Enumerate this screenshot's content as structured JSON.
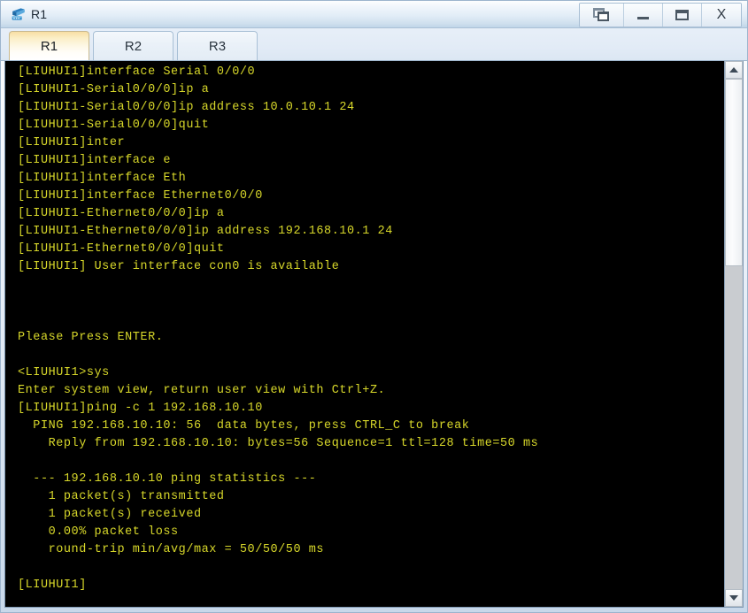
{
  "window": {
    "title": "R1",
    "icon": "router-icon",
    "controls": {
      "restore_label": "",
      "minimize_label": "",
      "maximize_label": "",
      "close_label": "X"
    }
  },
  "tabs": [
    {
      "label": "R1",
      "active": true
    },
    {
      "label": "R2",
      "active": false
    },
    {
      "label": "R3",
      "active": false
    }
  ],
  "terminal": {
    "foreground_color": "#d8d82a",
    "background_color": "#000000",
    "lines": [
      "[LIUHUI1]interface Serial 0/0/0",
      "[LIUHUI1-Serial0/0/0]ip a",
      "[LIUHUI1-Serial0/0/0]ip address 10.0.10.1 24",
      "[LIUHUI1-Serial0/0/0]quit",
      "[LIUHUI1]inter",
      "[LIUHUI1]interface e",
      "[LIUHUI1]interface Eth",
      "[LIUHUI1]interface Ethernet0/0/0",
      "[LIUHUI1-Ethernet0/0/0]ip a",
      "[LIUHUI1-Ethernet0/0/0]ip address 192.168.10.1 24",
      "[LIUHUI1-Ethernet0/0/0]quit",
      "[LIUHUI1] User interface con0 is available",
      "",
      "",
      "",
      "Please Press ENTER.",
      "",
      "<LIUHUI1>sys",
      "Enter system view, return user view with Ctrl+Z.",
      "[LIUHUI1]ping -c 1 192.168.10.10",
      "  PING 192.168.10.10: 56  data bytes, press CTRL_C to break",
      "    Reply from 192.168.10.10: bytes=56 Sequence=1 ttl=128 time=50 ms",
      "",
      "  --- 192.168.10.10 ping statistics ---",
      "    1 packet(s) transmitted",
      "    1 packet(s) received",
      "    0.00% packet loss",
      "    round-trip min/avg/max = 50/50/50 ms",
      "",
      "[LIUHUI1]"
    ]
  },
  "scrollbar": {
    "up_arrow": "chevron-up-icon",
    "down_arrow": "chevron-down-icon"
  }
}
